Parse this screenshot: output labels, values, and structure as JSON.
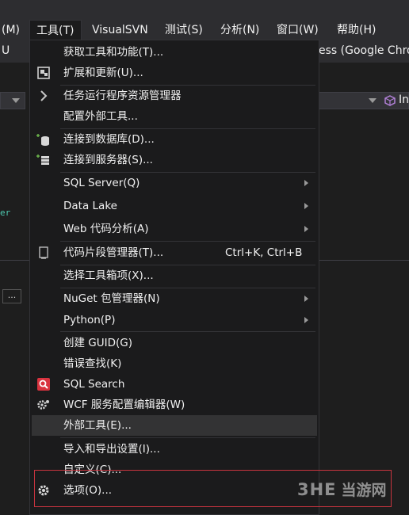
{
  "menubar": {
    "items": [
      {
        "label": "(M)"
      },
      {
        "label": "工具(T)"
      },
      {
        "label": "VisualSVN"
      },
      {
        "label": "测试(S)"
      },
      {
        "label": "分析(N)"
      },
      {
        "label": "窗口(W)"
      },
      {
        "label": "帮助(H)"
      }
    ]
  },
  "toolbar": {
    "left_text": "U",
    "right_text": "ess (Google Chro",
    "combo_right_text": "In"
  },
  "background": {
    "code_stub": "er",
    "ellipsis_button": "..."
  },
  "tools_menu": {
    "items": [
      {
        "label": "获取工具和功能(T)...",
        "icon": "none"
      },
      {
        "label": "扩展和更新(U)...",
        "icon": "extensions-icon"
      },
      {
        "label": "任务运行程序资源管理器",
        "icon": "chevron-right-icon"
      },
      {
        "label": "配置外部工具...",
        "icon": "none"
      },
      {
        "label": "连接到数据库(D)...",
        "icon": "database-connect-icon"
      },
      {
        "label": "连接到服务器(S)...",
        "icon": "server-connect-icon"
      },
      {
        "label": "SQL Server(Q)",
        "icon": "none",
        "submenu": true
      },
      {
        "label": "Data Lake",
        "icon": "none",
        "submenu": true
      },
      {
        "label": "Web 代码分析(A)",
        "icon": "none",
        "submenu": true
      },
      {
        "label": "代码片段管理器(T)...",
        "shortcut": "Ctrl+K, Ctrl+B",
        "icon": "snippet-icon"
      },
      {
        "label": "选择工具箱项(X)...",
        "icon": "none"
      },
      {
        "label": "NuGet 包管理器(N)",
        "icon": "none",
        "submenu": true
      },
      {
        "label": "Python(P)",
        "icon": "none",
        "submenu": true
      },
      {
        "label": "创建 GUID(G)",
        "icon": "none"
      },
      {
        "label": "错误查找(K)",
        "icon": "none"
      },
      {
        "label": "SQL Search",
        "icon": "sql-search-icon"
      },
      {
        "label": "WCF 服务配置编辑器(W)",
        "icon": "wcf-gear-icon"
      },
      {
        "label": "外部工具(E)...",
        "icon": "none",
        "highlighted": true
      },
      {
        "label": "导入和导出设置(I)...",
        "icon": "none"
      },
      {
        "label": "自定义(C)...",
        "icon": "none"
      },
      {
        "label": "选项(O)...",
        "icon": "gear-icon"
      }
    ]
  },
  "watermark": {
    "logo": "3HE",
    "site": "当游网"
  },
  "colors": {
    "menu_bg": "#1b1b1c",
    "menubar_bg": "#2d2d30",
    "highlight": "#333334",
    "annotation_red": "#c8343f"
  }
}
